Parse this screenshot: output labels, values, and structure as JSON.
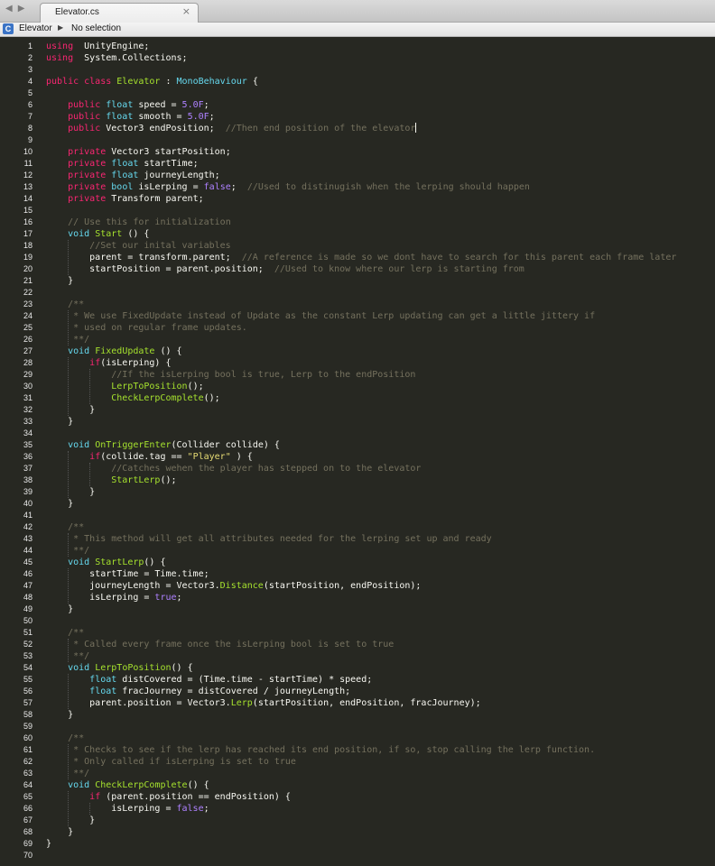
{
  "window": {
    "tab_title": "Elevator.cs",
    "tab_close": "×",
    "nav_back": "◀",
    "nav_forward": "▶"
  },
  "breadcrumb": {
    "icon": "C",
    "file": "Elevator",
    "separator": "▶",
    "selection": "No selection"
  },
  "editor": {
    "language": "C#",
    "theme_colors": {
      "background": "#272822",
      "keyword": "#f92672",
      "type": "#66d9ef",
      "function": "#a6e22e",
      "string": "#e6db74",
      "number": "#ae81ff",
      "comment": "#75715e",
      "text": "#f8f8f2"
    },
    "cursor_line": 8,
    "lines": [
      [
        [
          "k",
          "using"
        ],
        [
          "",
          "  UnityEngine;"
        ]
      ],
      [
        [
          "k",
          "using"
        ],
        [
          "",
          "  System.Collections;"
        ]
      ],
      [],
      [
        [
          "k",
          "public class"
        ],
        [
          "",
          " "
        ],
        [
          "f",
          "Elevator"
        ],
        [
          "",
          " : "
        ],
        [
          "t",
          "MonoBehaviour"
        ],
        [
          "",
          " {"
        ]
      ],
      [],
      [
        [
          "",
          "    "
        ],
        [
          "k",
          "public"
        ],
        [
          "",
          " "
        ],
        [
          "t",
          "float"
        ],
        [
          "",
          " speed = "
        ],
        [
          "n",
          "5.0F"
        ],
        [
          "",
          ";"
        ]
      ],
      [
        [
          "",
          "    "
        ],
        [
          "k",
          "public"
        ],
        [
          "",
          " "
        ],
        [
          "t",
          "float"
        ],
        [
          "",
          " smooth = "
        ],
        [
          "n",
          "5.0F"
        ],
        [
          "",
          ";"
        ]
      ],
      [
        [
          "",
          "    "
        ],
        [
          "k",
          "public"
        ],
        [
          "",
          " Vector3 endPosition;  "
        ],
        [
          "c",
          "//Then end position of the elevator"
        ]
      ],
      [],
      [
        [
          "",
          "    "
        ],
        [
          "k",
          "private"
        ],
        [
          "",
          " Vector3 startPosition;"
        ]
      ],
      [
        [
          "",
          "    "
        ],
        [
          "k",
          "private"
        ],
        [
          "",
          " "
        ],
        [
          "t",
          "float"
        ],
        [
          "",
          " startTime;"
        ]
      ],
      [
        [
          "",
          "    "
        ],
        [
          "k",
          "private"
        ],
        [
          "",
          " "
        ],
        [
          "t",
          "float"
        ],
        [
          "",
          " journeyLength;"
        ]
      ],
      [
        [
          "",
          "    "
        ],
        [
          "k",
          "private"
        ],
        [
          "",
          " "
        ],
        [
          "t",
          "bool"
        ],
        [
          "",
          " isLerping = "
        ],
        [
          "n",
          "false"
        ],
        [
          "",
          ";  "
        ],
        [
          "c",
          "//Used to distinugish when the lerping should happen"
        ]
      ],
      [
        [
          "",
          "    "
        ],
        [
          "k",
          "private"
        ],
        [
          "",
          " Transform parent;"
        ]
      ],
      [],
      [
        [
          "",
          "    "
        ],
        [
          "c",
          "// Use this for initialization"
        ]
      ],
      [
        [
          "",
          "    "
        ],
        [
          "t",
          "void"
        ],
        [
          "",
          " "
        ],
        [
          "f",
          "Start"
        ],
        [
          "",
          " () {"
        ]
      ],
      [
        [
          "",
          "        "
        ],
        [
          "c",
          "//Set our inital variables"
        ]
      ],
      [
        [
          "",
          "        parent = transform.parent;  "
        ],
        [
          "c",
          "//A reference is made so we dont have to search for this parent each frame later"
        ]
      ],
      [
        [
          "",
          "        startPosition = parent.position;  "
        ],
        [
          "c",
          "//Used to know where our lerp is starting from"
        ]
      ],
      [
        [
          "",
          "    }"
        ]
      ],
      [],
      [
        [
          "",
          "    "
        ],
        [
          "c",
          "/**"
        ]
      ],
      [
        [
          "",
          "    "
        ],
        [
          "c",
          " * We use FixedUpdate instead of Update as the constant Lerp updating can get a little jittery if"
        ]
      ],
      [
        [
          "",
          "    "
        ],
        [
          "c",
          " * used on regular frame updates."
        ]
      ],
      [
        [
          "",
          "    "
        ],
        [
          "c",
          " **/"
        ]
      ],
      [
        [
          "",
          "    "
        ],
        [
          "t",
          "void"
        ],
        [
          "",
          " "
        ],
        [
          "f",
          "FixedUpdate"
        ],
        [
          "",
          " () {"
        ]
      ],
      [
        [
          "",
          "        "
        ],
        [
          "k",
          "if"
        ],
        [
          "",
          "(isLerping) {"
        ]
      ],
      [
        [
          "",
          "            "
        ],
        [
          "c",
          "//If the isLerping bool is true, Lerp to the endPosition"
        ]
      ],
      [
        [
          "",
          "            "
        ],
        [
          "f",
          "LerpToPosition"
        ],
        [
          "",
          "();"
        ]
      ],
      [
        [
          "",
          "            "
        ],
        [
          "f",
          "CheckLerpComplete"
        ],
        [
          "",
          "();"
        ]
      ],
      [
        [
          "",
          "        }"
        ]
      ],
      [
        [
          "",
          "    }"
        ]
      ],
      [],
      [
        [
          "",
          "    "
        ],
        [
          "t",
          "void"
        ],
        [
          "",
          " "
        ],
        [
          "f",
          "OnTriggerEnter"
        ],
        [
          "",
          "(Collider collide) {"
        ]
      ],
      [
        [
          "",
          "        "
        ],
        [
          "k",
          "if"
        ],
        [
          "",
          "(collide.tag == "
        ],
        [
          "s",
          "\"Player\""
        ],
        [
          "",
          " ) {"
        ]
      ],
      [
        [
          "",
          "            "
        ],
        [
          "c",
          "//Catches wehen the player has stepped on to the elevator"
        ]
      ],
      [
        [
          "",
          "            "
        ],
        [
          "f",
          "StartLerp"
        ],
        [
          "",
          "();"
        ]
      ],
      [
        [
          "",
          "        }"
        ]
      ],
      [
        [
          "",
          "    }"
        ]
      ],
      [],
      [
        [
          "",
          "    "
        ],
        [
          "c",
          "/**"
        ]
      ],
      [
        [
          "",
          "    "
        ],
        [
          "c",
          " * This method will get all attributes needed for the lerping set up and ready"
        ]
      ],
      [
        [
          "",
          "    "
        ],
        [
          "c",
          " **/"
        ]
      ],
      [
        [
          "",
          "    "
        ],
        [
          "t",
          "void"
        ],
        [
          "",
          " "
        ],
        [
          "f",
          "StartLerp"
        ],
        [
          "",
          "() {"
        ]
      ],
      [
        [
          "",
          "        startTime = Time.time;"
        ]
      ],
      [
        [
          "",
          "        journeyLength = Vector3."
        ],
        [
          "f",
          "Distance"
        ],
        [
          "",
          "(startPosition, endPosition);"
        ]
      ],
      [
        [
          "",
          "        isLerping = "
        ],
        [
          "n",
          "true"
        ],
        [
          "",
          ";"
        ]
      ],
      [
        [
          "",
          "    }"
        ]
      ],
      [],
      [
        [
          "",
          "    "
        ],
        [
          "c",
          "/**"
        ]
      ],
      [
        [
          "",
          "    "
        ],
        [
          "c",
          " * Called every frame once the isLerping bool is set to true"
        ]
      ],
      [
        [
          "",
          "    "
        ],
        [
          "c",
          " **/"
        ]
      ],
      [
        [
          "",
          "    "
        ],
        [
          "t",
          "void"
        ],
        [
          "",
          " "
        ],
        [
          "f",
          "LerpToPosition"
        ],
        [
          "",
          "() {"
        ]
      ],
      [
        [
          "",
          "        "
        ],
        [
          "t",
          "float"
        ],
        [
          "",
          " distCovered = (Time.time - startTime) * speed;"
        ]
      ],
      [
        [
          "",
          "        "
        ],
        [
          "t",
          "float"
        ],
        [
          "",
          " fracJourney = distCovered / journeyLength;"
        ]
      ],
      [
        [
          "",
          "        parent.position = Vector3."
        ],
        [
          "f",
          "Lerp"
        ],
        [
          "",
          "(startPosition, endPosition, fracJourney);"
        ]
      ],
      [
        [
          "",
          "    }"
        ]
      ],
      [],
      [
        [
          "",
          "    "
        ],
        [
          "c",
          "/**"
        ]
      ],
      [
        [
          "",
          "    "
        ],
        [
          "c",
          " * Checks to see if the lerp has reached its end position, if so, stop calling the lerp function."
        ]
      ],
      [
        [
          "",
          "    "
        ],
        [
          "c",
          " * Only called if isLerping is set to true"
        ]
      ],
      [
        [
          "",
          "    "
        ],
        [
          "c",
          " **/"
        ]
      ],
      [
        [
          "",
          "    "
        ],
        [
          "t",
          "void"
        ],
        [
          "",
          " "
        ],
        [
          "f",
          "CheckLerpComplete"
        ],
        [
          "",
          "() {"
        ]
      ],
      [
        [
          "",
          "        "
        ],
        [
          "k",
          "if"
        ],
        [
          "",
          " (parent.position == endPosition) {"
        ]
      ],
      [
        [
          "",
          "            isLerping = "
        ],
        [
          "n",
          "false"
        ],
        [
          "",
          ";"
        ]
      ],
      [
        [
          "",
          "        }"
        ]
      ],
      [
        [
          "",
          "    }"
        ]
      ],
      [
        [
          "",
          "}"
        ]
      ],
      []
    ]
  }
}
